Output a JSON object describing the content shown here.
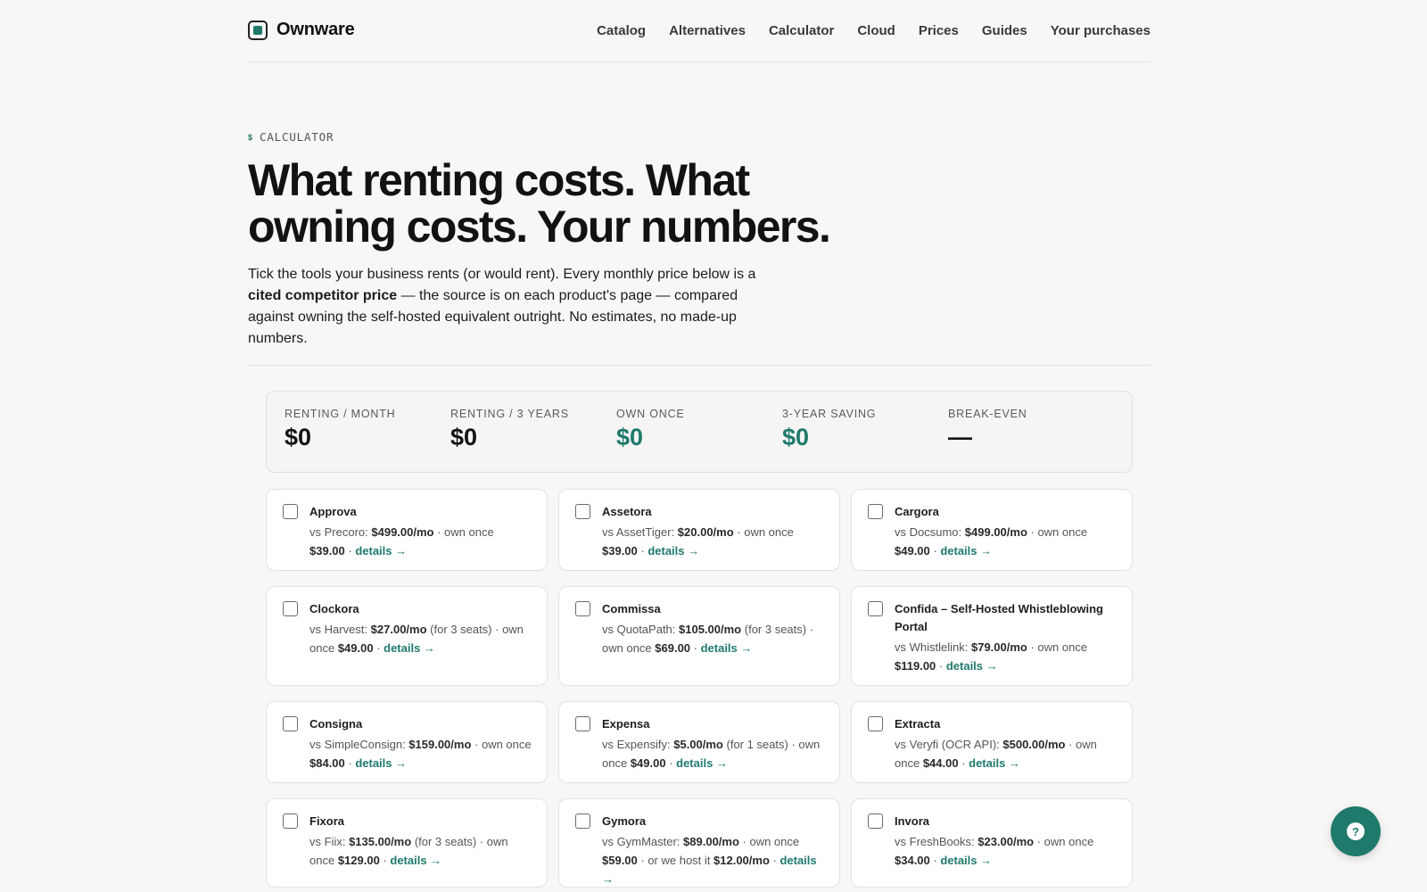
{
  "brand": {
    "name": "Ownware"
  },
  "nav": [
    "Catalog",
    "Alternatives",
    "Calculator",
    "Cloud",
    "Prices",
    "Guides",
    "Your purchases"
  ],
  "hero": {
    "eyebrow_icon": "$",
    "eyebrow": "CALCULATOR",
    "title": "What renting costs. What owning costs. Your numbers.",
    "lead_before": "Tick the tools your business rents (or would rent). Every monthly price below is a ",
    "lead_strong": "cited competitor price",
    "lead_after": " — the source is on each product's page — compared against owning the self-hosted equivalent outright. No estimates, no made-up numbers."
  },
  "summary": [
    {
      "label": "RENTING / MONTH",
      "value": "$0",
      "accent": false
    },
    {
      "label": "RENTING / 3 YEARS",
      "value": "$0",
      "accent": false
    },
    {
      "label": "OWN ONCE",
      "value": "$0",
      "accent": true
    },
    {
      "label": "3-YEAR SAVING",
      "value": "$0",
      "accent": true
    },
    {
      "label": "BREAK-EVEN",
      "value": "—",
      "accent": false
    }
  ],
  "details_label": "details →",
  "products": [
    {
      "name": "Approva",
      "competitor": "Precoro",
      "rent": "$499.00/mo",
      "seats": "",
      "own": "$39.00",
      "hosted": ""
    },
    {
      "name": "Assetora",
      "competitor": "AssetTiger",
      "rent": "$20.00/mo",
      "seats": "",
      "own": "$39.00",
      "hosted": ""
    },
    {
      "name": "Cargora",
      "competitor": "Docsumo",
      "rent": "$499.00/mo",
      "seats": "",
      "own": "$49.00",
      "hosted": ""
    },
    {
      "name": "Clockora",
      "competitor": "Harvest",
      "rent": "$27.00/mo",
      "seats": "(for 3 seats)",
      "own": "$49.00",
      "hosted": ""
    },
    {
      "name": "Commissa",
      "competitor": "QuotaPath",
      "rent": "$105.00/mo",
      "seats": "(for 3 seats)",
      "own": "$69.00",
      "hosted": ""
    },
    {
      "name": "Confida – Self-Hosted Whistleblowing Portal",
      "competitor": "Whistlelink",
      "rent": "$79.00/mo",
      "seats": "",
      "own": "$119.00",
      "hosted": ""
    },
    {
      "name": "Consigna",
      "competitor": "SimpleConsign",
      "rent": "$159.00/mo",
      "seats": "",
      "own": "$84.00",
      "hosted": ""
    },
    {
      "name": "Expensa",
      "competitor": "Expensify",
      "rent": "$5.00/mo",
      "seats": "(for 1 seats)",
      "own": "$49.00",
      "hosted": ""
    },
    {
      "name": "Extracta",
      "competitor": "Veryfi (OCR API)",
      "rent": "$500.00/mo",
      "seats": "",
      "own": "$44.00",
      "hosted": ""
    },
    {
      "name": "Fixora",
      "competitor": "Fiix",
      "rent": "$135.00/mo",
      "seats": "(for 3 seats)",
      "own": "$129.00",
      "hosted": ""
    },
    {
      "name": "Gymora",
      "competitor": "GymMaster",
      "rent": "$89.00/mo",
      "seats": "",
      "own": "$59.00",
      "hosted": "$12.00/mo"
    },
    {
      "name": "Invora",
      "competitor": "FreshBooks",
      "rent": "$23.00/mo",
      "seats": "",
      "own": "$34.00",
      "hosted": ""
    }
  ]
}
